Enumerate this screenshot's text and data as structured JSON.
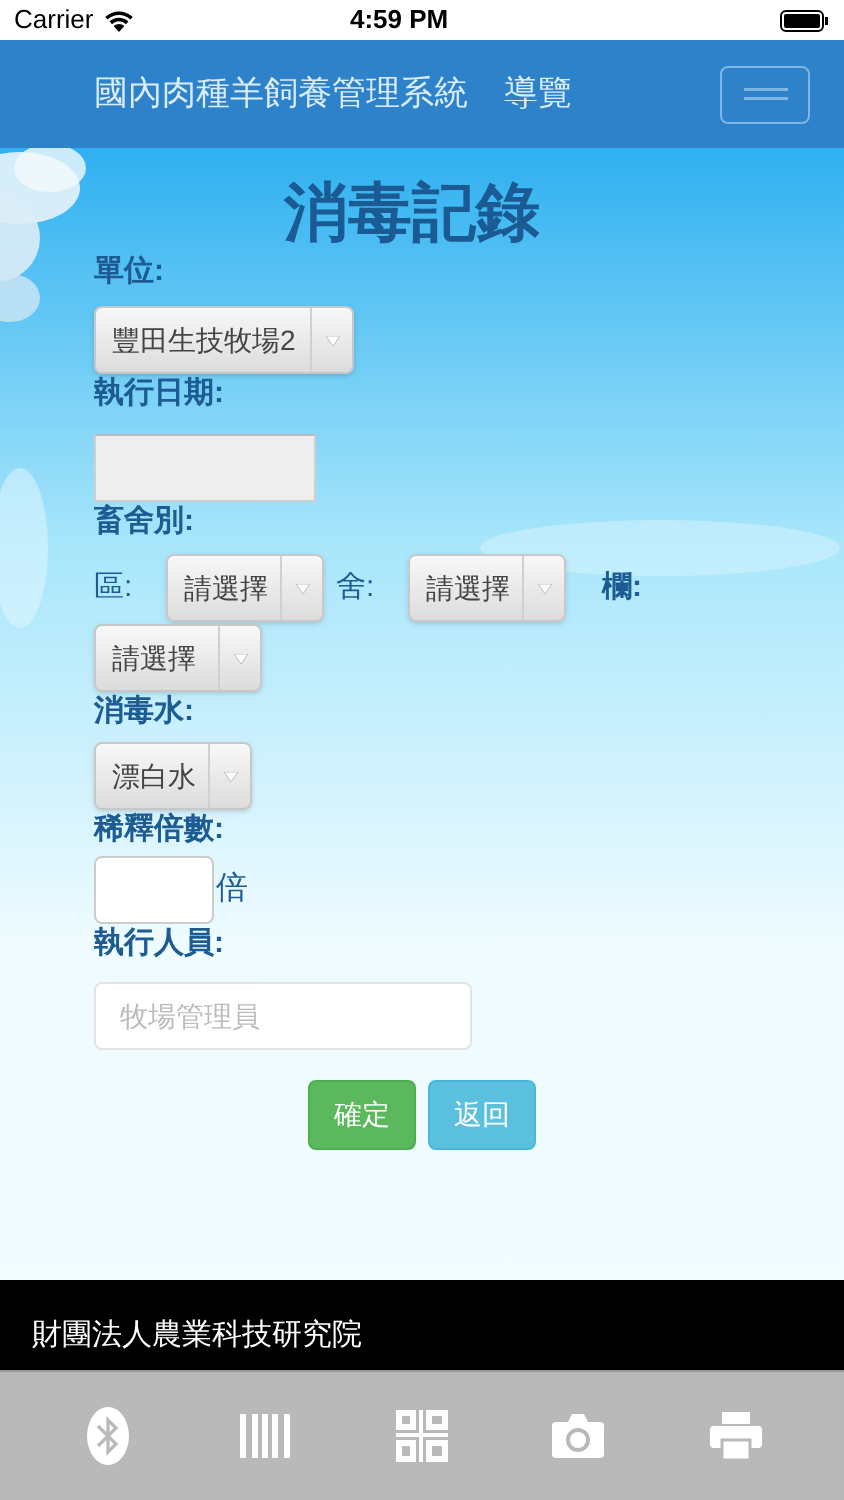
{
  "status_bar": {
    "carrier": "Carrier",
    "time": "4:59 PM"
  },
  "navbar": {
    "brand": "國內肉種羊飼養管理系統",
    "nav_link": "導覽"
  },
  "page_title": "消毒記錄",
  "unit": {
    "label": "單位:",
    "value": "豐田生技牧場2"
  },
  "date": {
    "label": "執行日期:"
  },
  "barn": {
    "label": "畜舍別:",
    "area_label": "區:",
    "area_value": "請選擇",
    "house_label": "舍:",
    "house_value": "請選擇",
    "pen_label": "欄:",
    "pen_value": "請選擇"
  },
  "disinfectant": {
    "label": "消毒水:",
    "value": "漂白水"
  },
  "dilution": {
    "label": "稀釋倍數:",
    "unit": "倍"
  },
  "operator": {
    "label": "執行人員:",
    "placeholder": "牧場管理員"
  },
  "buttons": [
    {
      "label": "確定",
      "kind": "primary"
    },
    {
      "label": "返回",
      "kind": "secondary"
    }
  ],
  "footer": "財團法人農業科技研究院",
  "toolbar": [
    {
      "kind": "bluetooth"
    },
    {
      "kind": "barcode"
    },
    {
      "kind": "qrcode"
    },
    {
      "kind": "camera"
    },
    {
      "kind": "printer"
    }
  ]
}
